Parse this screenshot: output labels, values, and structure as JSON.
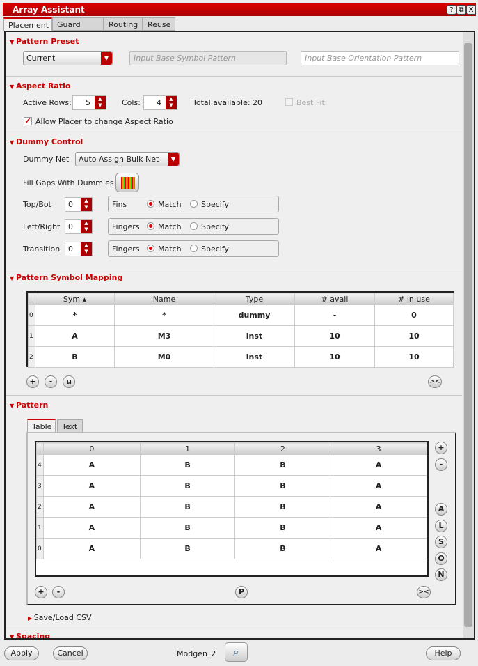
{
  "window": {
    "title": "Array Assistant",
    "help": "?",
    "restore": "⧉",
    "close": "X"
  },
  "tabs": [
    "Placement",
    "Guard Ring",
    "Routing",
    "Reuse"
  ],
  "pattern_preset": {
    "title": "Pattern Preset",
    "preset": "Current",
    "symbol_placeholder": "Input Base Symbol Pattern",
    "orientation_placeholder": "Input Base Orientation Pattern"
  },
  "aspect_ratio": {
    "title": "Aspect Ratio",
    "rows_label": "Active Rows:",
    "rows": "5",
    "cols_label": "Cols:",
    "cols": "4",
    "total": "Total available: 20",
    "best_fit": "Best Fit",
    "allow": "Allow Placer to change Aspect Ratio"
  },
  "dummy": {
    "title": "Dummy Control",
    "net_label": "Dummy Net",
    "net": "Auto Assign Bulk Net",
    "fill_label": "Fill Gaps With Dummies",
    "rows": [
      {
        "label": "Top/Bot",
        "value": "0",
        "kind": "Fins"
      },
      {
        "label": "Left/Right",
        "value": "0",
        "kind": "Fingers"
      },
      {
        "label": "Transition",
        "value": "0",
        "kind": "Fingers"
      }
    ],
    "match": "Match",
    "specify": "Specify"
  },
  "mapping": {
    "title": "Pattern Symbol Mapping",
    "headers": [
      "Sym",
      "Name",
      "Type",
      "# avail",
      "# in use"
    ],
    "rows": [
      {
        "i": "0",
        "c": [
          "*",
          "*",
          "dummy",
          "-",
          "0"
        ]
      },
      {
        "i": "1",
        "c": [
          "A",
          "M3",
          "inst",
          "10",
          "10"
        ]
      },
      {
        "i": "2",
        "c": [
          "B",
          "M0",
          "inst",
          "10",
          "10"
        ]
      }
    ],
    "buttons": [
      "+",
      "-",
      "u",
      "><"
    ]
  },
  "pattern": {
    "title": "Pattern",
    "tabs": [
      "Table",
      "Text"
    ],
    "headers": [
      "0",
      "1",
      "2",
      "3"
    ],
    "rows": [
      {
        "i": "4",
        "c": [
          "A",
          "B",
          "B",
          "A"
        ]
      },
      {
        "i": "3",
        "c": [
          "A",
          "B",
          "B",
          "A"
        ]
      },
      {
        "i": "2",
        "c": [
          "A",
          "B",
          "B",
          "A"
        ]
      },
      {
        "i": "1",
        "c": [
          "A",
          "B",
          "B",
          "A"
        ]
      },
      {
        "i": "0",
        "c": [
          "A",
          "B",
          "B",
          "A"
        ]
      }
    ],
    "side_buttons": [
      "+",
      "-",
      "A",
      "L",
      "S",
      "O",
      "N"
    ],
    "bottom_buttons": [
      "+",
      "-",
      "P",
      "><"
    ],
    "csv": "Save/Load CSV"
  },
  "spacing": {
    "title": "Spacing"
  },
  "footer": {
    "apply": "Apply",
    "cancel": "Cancel",
    "name": "Modgen_2",
    "help": "Help"
  }
}
